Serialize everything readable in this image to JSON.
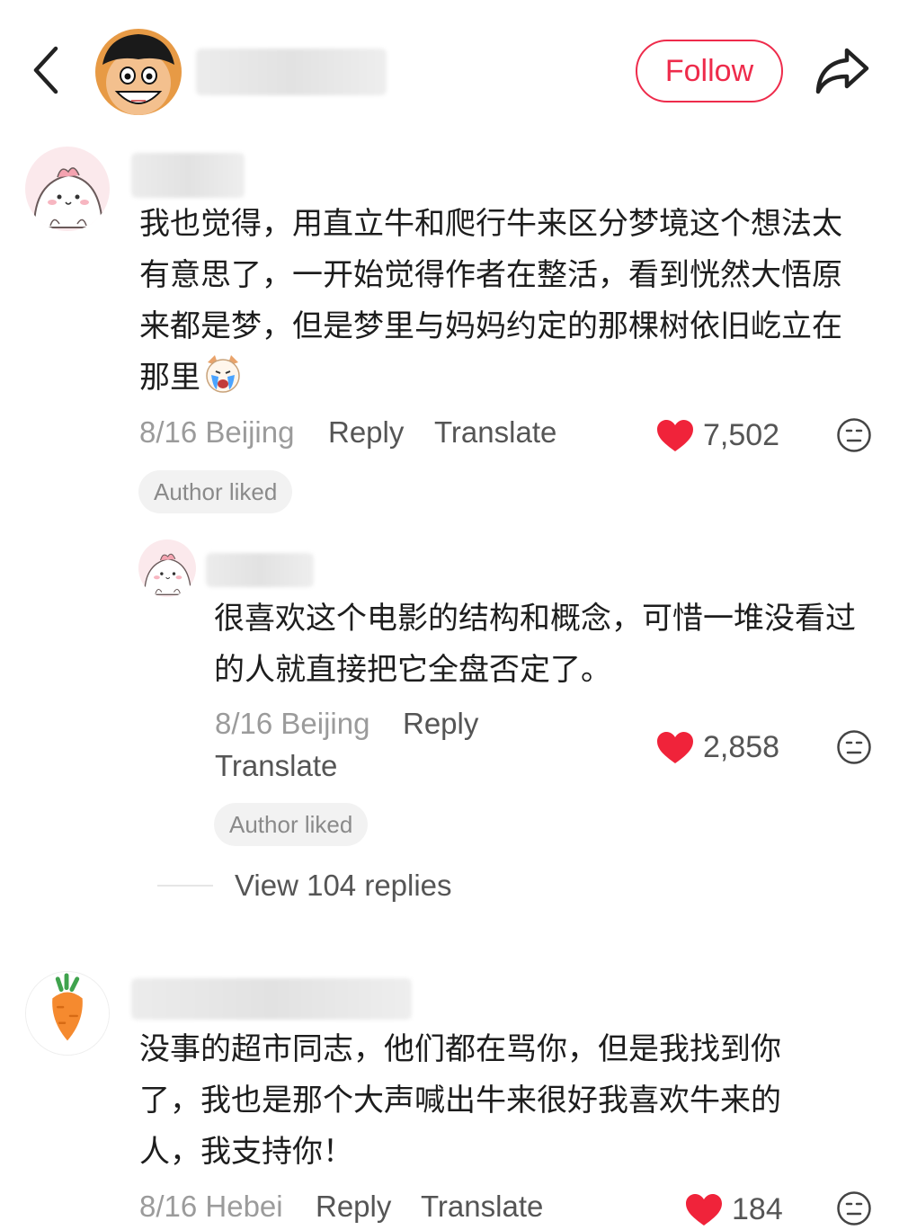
{
  "header": {
    "follow_label": "Follow"
  },
  "colors": {
    "accent": "#ee2b4b",
    "heart": "#f0233a"
  },
  "comments": [
    {
      "text": "我也觉得，用直立牛和爬行牛来区分梦境这个想法太有意思了，一开始觉得作者在整活，看到恍然大悟原来都是梦，但是梦里与妈妈约定的那棵树依旧屹立在那里",
      "date_location": "8/16 Beijing",
      "reply_label": "Reply",
      "translate_label": "Translate",
      "likes": "7,502",
      "badge": "Author liked",
      "avatar_icon": "pink-dino-avatar",
      "inline_emoji": "crying-dog-emoji"
    },
    {
      "text": "很喜欢这个电影的结构和概念，可惜一堆没看过的人就直接把它全盘否定了。",
      "date_location": "8/16 Beijing",
      "reply_label": "Reply",
      "translate_label": "Translate",
      "likes": "2,858",
      "badge": "Author liked",
      "avatar_icon": "pink-dino-avatar"
    },
    {
      "text": "没事的超市同志，他们都在骂你，但是我找到你了，我也是那个大声喊出牛来很好我喜欢牛来的人，我支持你！",
      "date_location": "8/16 Hebei",
      "reply_label": "Reply",
      "translate_label": "Translate",
      "likes": "184",
      "avatar_icon": "carrot-avatar"
    }
  ],
  "view_replies_label": "View 104 replies"
}
